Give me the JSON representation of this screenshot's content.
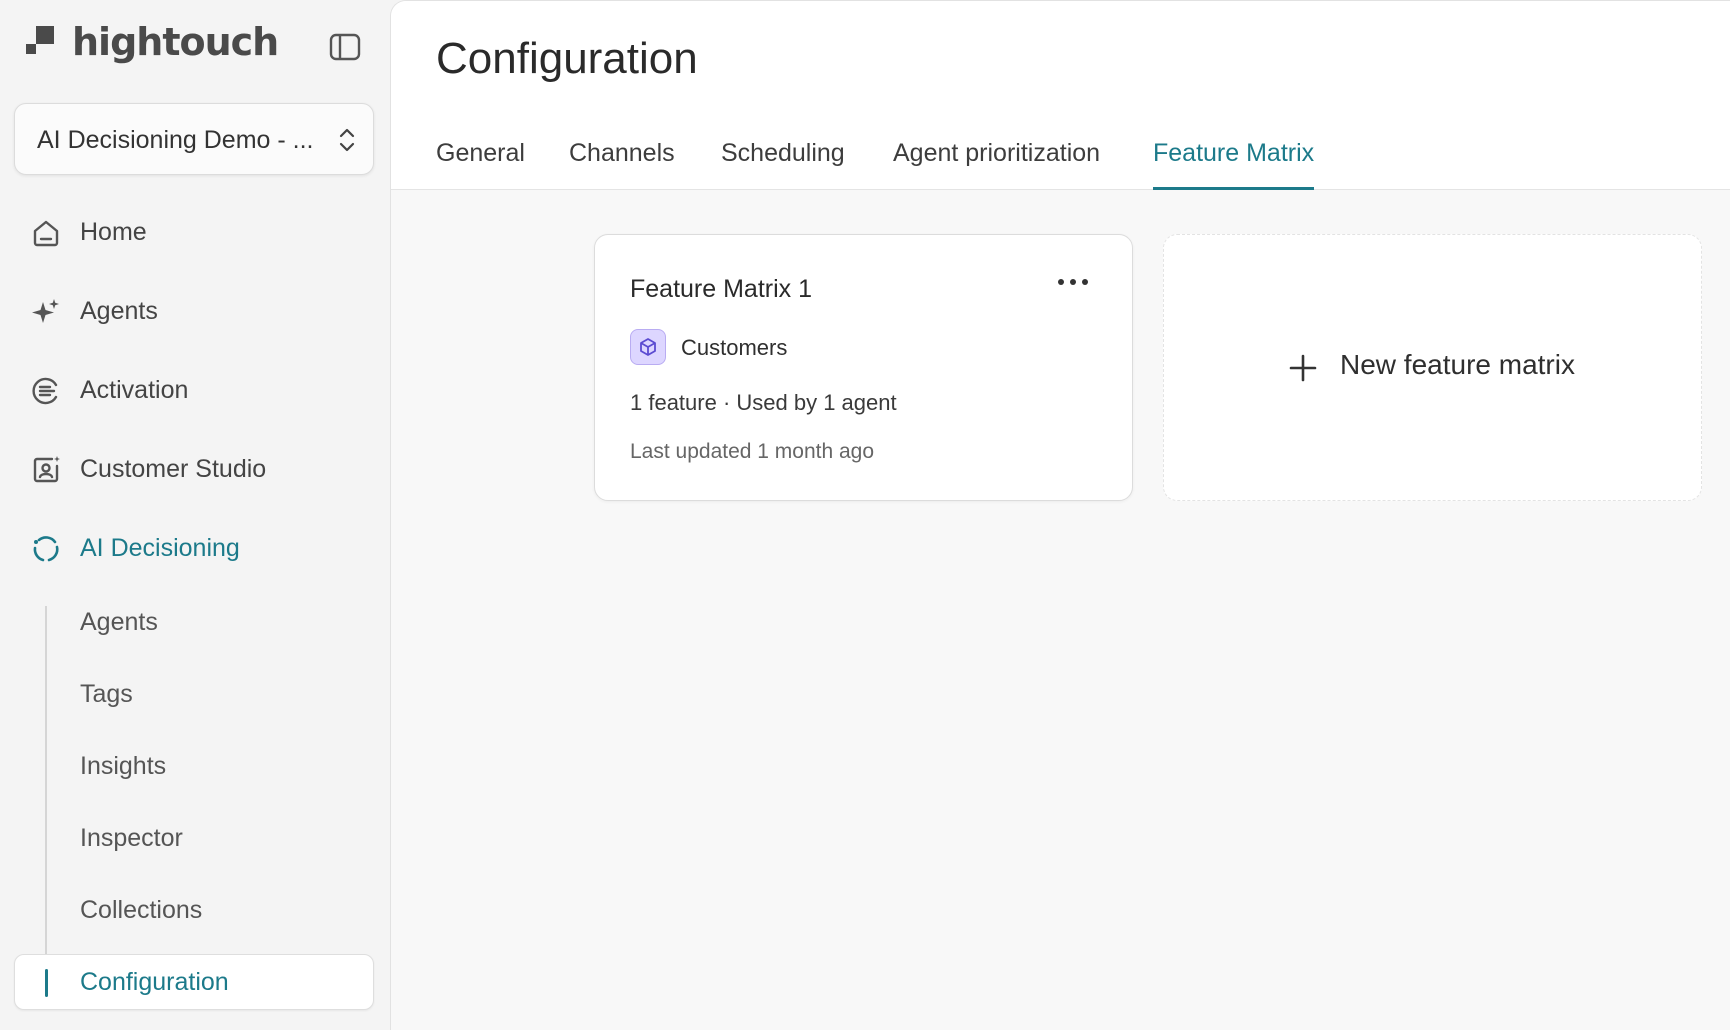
{
  "app": {
    "brand": "hightouch",
    "workspace": "AI Decisioning Demo - ..."
  },
  "sidebar": {
    "items": [
      {
        "label": "Home",
        "icon": "home-icon"
      },
      {
        "label": "Agents",
        "icon": "sparkle-icon"
      },
      {
        "label": "Activation",
        "icon": "activation-icon"
      },
      {
        "label": "Customer Studio",
        "icon": "customer-studio-icon"
      },
      {
        "label": "AI Decisioning",
        "icon": "ai-decisioning-icon",
        "active": true
      }
    ],
    "sub_items": [
      {
        "label": "Agents"
      },
      {
        "label": "Tags"
      },
      {
        "label": "Insights"
      },
      {
        "label": "Inspector"
      },
      {
        "label": "Collections"
      },
      {
        "label": "Configuration",
        "active": true
      }
    ]
  },
  "main": {
    "title": "Configuration",
    "tabs": [
      {
        "label": "General"
      },
      {
        "label": "Channels"
      },
      {
        "label": "Scheduling"
      },
      {
        "label": "Agent prioritization"
      },
      {
        "label": "Feature Matrix",
        "active": true
      }
    ],
    "cards": [
      {
        "title": "Feature Matrix 1",
        "model": "Customers",
        "meta": "1 feature · Used by 1 agent",
        "updated": "Last updated 1 month ago"
      }
    ],
    "new_card_label": "New feature matrix"
  },
  "colors": {
    "accent": "#1c7a8a",
    "model_badge": "#ddd6ff",
    "model_icon": "#5b4bd1"
  }
}
